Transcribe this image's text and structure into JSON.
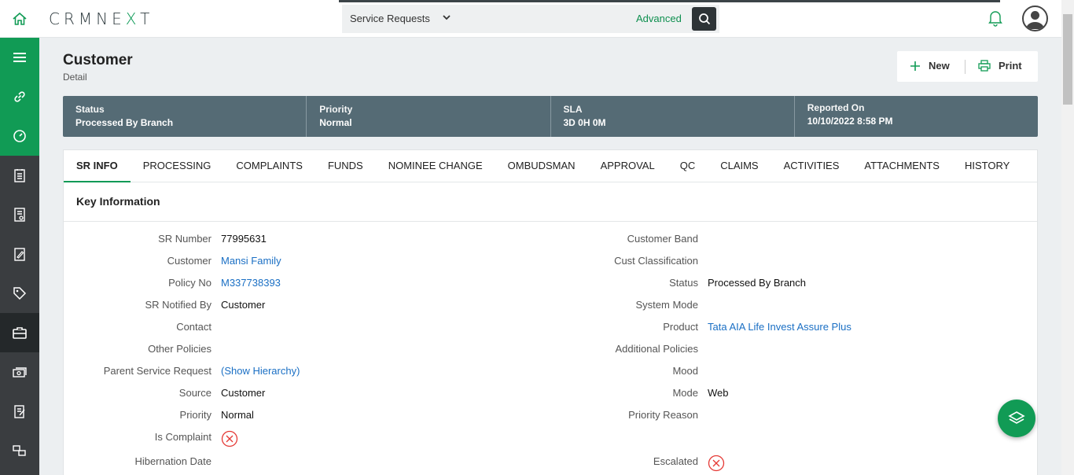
{
  "app": {
    "logo_left": "CRMNE",
    "logo_x": "X",
    "logo_right": "T"
  },
  "search": {
    "module": "Service Requests",
    "advanced": "Advanced"
  },
  "page": {
    "title": "Customer",
    "subtitle": "Detail"
  },
  "actions": {
    "new": "New",
    "print": "Print"
  },
  "status": [
    {
      "label": "Status",
      "value": "Processed By Branch"
    },
    {
      "label": "Priority",
      "value": "Normal"
    },
    {
      "label": "SLA",
      "value": "3D 0H 0M"
    },
    {
      "label": "Reported On",
      "value": "10/10/2022 8:58 PM"
    }
  ],
  "tabs": [
    "SR INFO",
    "PROCESSING",
    "COMPLAINTS",
    "FUNDS",
    "NOMINEE CHANGE",
    "OMBUDSMAN",
    "APPROVAL",
    "QC",
    "CLAIMS",
    "ACTIVITIES",
    "ATTACHMENTS",
    "HISTORY"
  ],
  "section": {
    "title": "Key Information"
  },
  "left_fields": [
    {
      "label": "SR Number",
      "value": "77995631"
    },
    {
      "label": "Customer",
      "value": "Mansi Family"
    },
    {
      "label": "Policy No",
      "value": "M337738393"
    },
    {
      "label": "SR Notified By",
      "value": "Customer"
    },
    {
      "label": "Contact",
      "value": ""
    },
    {
      "label": "Other Policies",
      "value": ""
    },
    {
      "label": "Parent Service Request",
      "value": "(Show Hierarchy)"
    },
    {
      "label": "Source",
      "value": "Customer"
    },
    {
      "label": "Priority",
      "value": "Normal"
    },
    {
      "label": "Is Complaint",
      "value": ""
    },
    {
      "label": "Hibernation Date",
      "value": ""
    }
  ],
  "right_fields": [
    {
      "label": "Customer Band",
      "value": ""
    },
    {
      "label": "Cust Classification",
      "value": ""
    },
    {
      "label": "Status",
      "value": "Processed By Branch"
    },
    {
      "label": "System Mode",
      "value": ""
    },
    {
      "label": "Product",
      "value": "Tata AIA Life Invest Assure Plus"
    },
    {
      "label": "Additional Policies",
      "value": ""
    },
    {
      "label": "Mood",
      "value": ""
    },
    {
      "label": "Mode",
      "value": "Web"
    },
    {
      "label": "Priority Reason",
      "value": ""
    },
    {
      "label": "Escalated",
      "value": ""
    }
  ],
  "colors": {
    "brand_green": "#119b55",
    "status_bar": "#556b75",
    "link": "#1a6fc4",
    "false_icon": "#e53935"
  },
  "icons": {
    "is_complaint": "x-circle-icon",
    "escalated": "x-circle-icon"
  }
}
